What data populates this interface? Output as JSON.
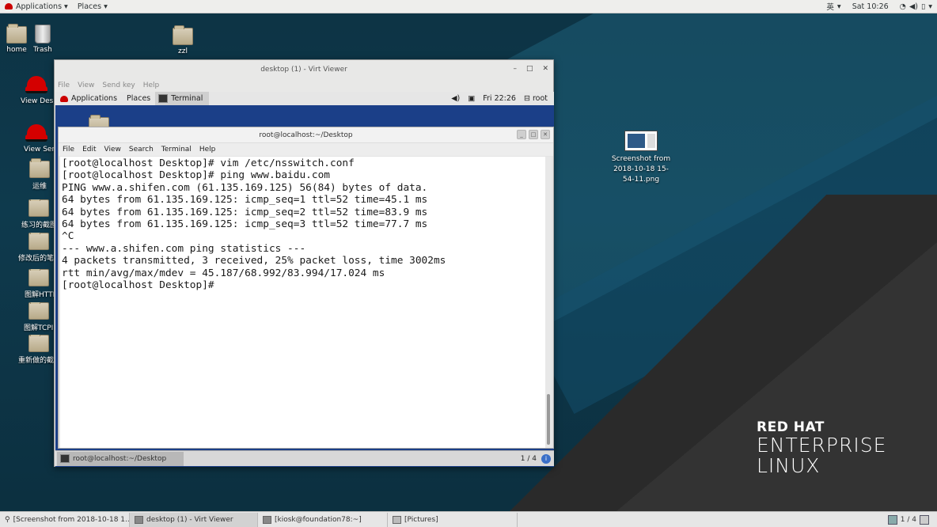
{
  "host_topbar": {
    "applications": "Applications",
    "places": "Places",
    "input_method": "英",
    "clock": "Sat 10:26"
  },
  "desktop_icons": [
    {
      "label": "home"
    },
    {
      "label": "Trash"
    },
    {
      "label": "zzl"
    },
    {
      "label": "View Desk"
    },
    {
      "label": "View Serv"
    },
    {
      "label": "运维"
    },
    {
      "label": "练习的截图"
    },
    {
      "label": "修改后的笔"
    },
    {
      "label": "图解HTTP"
    },
    {
      "label": "图解TCPI"
    },
    {
      "label": "重新做的截"
    },
    {
      "label": "Screenshot from 2018-10-18 15-54-11.png"
    }
  ],
  "rhel_logo": {
    "line1": "RED HAT",
    "line2": "ENTERPRISE",
    "line3": "LINUX"
  },
  "virt_viewer": {
    "title": "desktop (1) - Virt Viewer",
    "menu": [
      "File",
      "View",
      "Send key",
      "Help"
    ],
    "guest_topbar": {
      "applications": "Applications",
      "places": "Places",
      "terminal_tab": "Terminal",
      "clock": "Fri 22:26",
      "user": "root"
    },
    "terminal": {
      "title": "root@localhost:~/Desktop",
      "menu": [
        "File",
        "Edit",
        "View",
        "Search",
        "Terminal",
        "Help"
      ],
      "lines": [
        "[root@localhost Desktop]# vim /etc/nsswitch.conf",
        "[root@localhost Desktop]# ping www.baidu.com",
        "PING www.a.shifen.com (61.135.169.125) 56(84) bytes of data.",
        "64 bytes from 61.135.169.125: icmp_seq=1 ttl=52 time=45.1 ms",
        "64 bytes from 61.135.169.125: icmp_seq=2 ttl=52 time=83.9 ms",
        "64 bytes from 61.135.169.125: icmp_seq=3 ttl=52 time=77.7 ms",
        "^C",
        "--- www.a.shifen.com ping statistics ---",
        "4 packets transmitted, 3 received, 25% packet loss, time 3002ms",
        "rtt min/avg/max/mdev = 45.187/68.992/83.994/17.024 ms",
        "[root@localhost Desktop]# "
      ]
    },
    "guest_taskbar": {
      "task": "root@localhost:~/Desktop",
      "pager": "1 / 4"
    }
  },
  "host_taskbar": {
    "tasks": [
      "[Screenshot from 2018-10-18 1...",
      "desktop (1) - Virt Viewer",
      "[kiosk@foundation78:~]",
      "[Pictures]"
    ],
    "pager": "1 / 4"
  }
}
